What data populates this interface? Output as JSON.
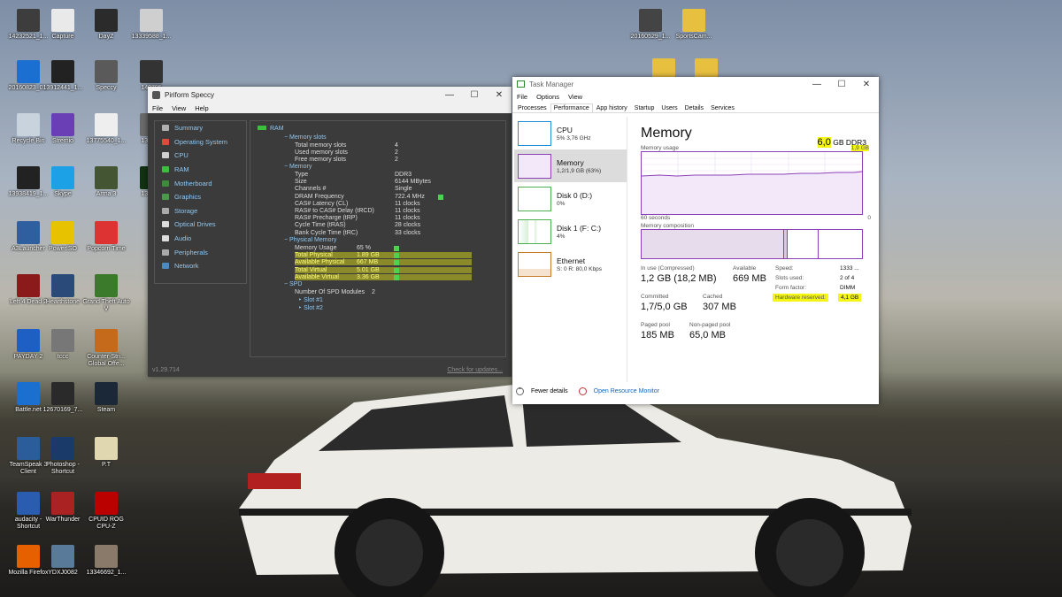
{
  "desktop_icons": [
    {
      "label": "14232521_1...",
      "color": "#3d3d3d"
    },
    {
      "label": "Capture",
      "color": "#e9e9e9"
    },
    {
      "label": "DayZ",
      "color": "#2b2b2b"
    },
    {
      "label": "13339588_1...",
      "color": "#cfcfcf"
    },
    {
      "label": "20160823_0...",
      "color": "#1a6fd1"
    },
    {
      "label": "13912441_1...",
      "color": "#222"
    },
    {
      "label": "Speccy",
      "color": "#5a5a5a"
    },
    {
      "label": "140795",
      "color": "#333"
    },
    {
      "label": "Recycle Bin",
      "color": "#c9d3de"
    },
    {
      "label": "Stremio",
      "color": "#6a3fb6"
    },
    {
      "label": "13775540_1...",
      "color": "#eeeeee"
    },
    {
      "label": "132661",
      "color": "#6b6b6b"
    },
    {
      "label": "13938419_1...",
      "color": "#222"
    },
    {
      "label": "Skype",
      "color": "#1da1e6"
    },
    {
      "label": "Arma 3",
      "color": "#445533"
    },
    {
      "label": "139129",
      "color": "#113311"
    },
    {
      "label": "A3Launcher",
      "color": "#2f5f9f"
    },
    {
      "label": "PowerISO",
      "color": "#e6c200"
    },
    {
      "label": "Popcorn Time",
      "color": "#d33"
    },
    {
      "label": "Left 4 Dead 2",
      "color": "#8b1a1a"
    },
    {
      "label": "Hearthstone",
      "color": "#2a4a7a"
    },
    {
      "label": "Grand Theft Auto V",
      "color": "#3a7a2a"
    },
    {
      "label": "PAYDAY 2",
      "color": "#1d5fc2"
    },
    {
      "label": "tccc",
      "color": "#777"
    },
    {
      "label": "Counter-Stri... Global Offe...",
      "color": "#c46a1a"
    },
    {
      "label": "Battle.net",
      "color": "#1b6fcf"
    },
    {
      "label": "12670169_7...",
      "color": "#2a2a2a"
    },
    {
      "label": "Steam",
      "color": "#1b2838"
    },
    {
      "label": "TeamSpeak 3 Client",
      "color": "#2b5d9a"
    },
    {
      "label": "Photoshop - Shortcut",
      "color": "#1a3a6a"
    },
    {
      "label": "P.T",
      "color": "#e0d7b0"
    },
    {
      "label": "audacity - Shortcut",
      "color": "#2a5db0"
    },
    {
      "label": "WarThunder",
      "color": "#a22"
    },
    {
      "label": "CPUID ROG CPU-Z",
      "color": "#b00"
    },
    {
      "label": "Mozilla Firefox",
      "color": "#e66000"
    },
    {
      "label": "YDXJ0082",
      "color": "#5a7a9a"
    },
    {
      "label": "13346692_1...",
      "color": "#8a7a6a"
    },
    {
      "label": "20160529_1...",
      "color": "#444"
    },
    {
      "label": "SportsCam...",
      "color": "#e8c040"
    }
  ],
  "speccy": {
    "title": "Piriform Speccy",
    "menu": [
      "File",
      "View",
      "Help"
    ],
    "nav": [
      {
        "label": "Summary",
        "color": "#b0b0b0"
      },
      {
        "label": "Operating System",
        "color": "#e04a3a"
      },
      {
        "label": "CPU",
        "color": "#d0d0d0"
      },
      {
        "label": "RAM",
        "color": "#3cbf3c"
      },
      {
        "label": "Motherboard",
        "color": "#3c8c3c"
      },
      {
        "label": "Graphics",
        "color": "#4a9a4a"
      },
      {
        "label": "Storage",
        "color": "#aaaaaa"
      },
      {
        "label": "Optical Drives",
        "color": "#dddddd"
      },
      {
        "label": "Audio",
        "color": "#dddddd"
      },
      {
        "label": "Peripherals",
        "color": "#aaaaaa"
      },
      {
        "label": "Network",
        "color": "#4a8ac0"
      }
    ],
    "ram_header": "RAM",
    "memory_slots": {
      "title": "Memory slots",
      "rows": [
        [
          "Total memory slots",
          "4"
        ],
        [
          "Used memory slots",
          "2"
        ],
        [
          "Free memory slots",
          "2"
        ]
      ]
    },
    "memory": {
      "title": "Memory",
      "rows": [
        [
          "Type",
          "DDR3"
        ],
        [
          "Size",
          "6144 MBytes"
        ],
        [
          "Channels #",
          "Single"
        ],
        [
          "DRAM Frequency",
          "722.4 MHz"
        ],
        [
          "CAS# Latency (CL)",
          "11 clocks"
        ],
        [
          "RAS# to CAS# Delay (tRCD)",
          "11 clocks"
        ],
        [
          "RAS# Precharge (tRP)",
          "11 clocks"
        ],
        [
          "Cycle Time (tRAS)",
          "28 clocks"
        ],
        [
          "Bank Cycle Time (tRC)",
          "33 clocks"
        ]
      ]
    },
    "physical_memory": {
      "title": "Physical Memory",
      "rows": [
        [
          "Memory Usage",
          "65 %"
        ],
        [
          "Total Physical",
          "1.89 GB"
        ],
        [
          "Available Physical",
          "667 MB"
        ],
        [
          "Total Virtual",
          "5.01 GB"
        ],
        [
          "Available Virtual",
          "3.36 GB"
        ]
      ]
    },
    "spd": {
      "title": "SPD",
      "modules_label": "Number Of SPD Modules",
      "modules_value": "2",
      "slots": [
        "Slot #1",
        "Slot #2"
      ]
    },
    "version": "v1.29.714",
    "check_updates": "Check for updates..."
  },
  "taskmgr": {
    "title": "Task Manager",
    "menu": [
      "File",
      "Options",
      "View"
    ],
    "tabs": [
      "Processes",
      "Performance",
      "App history",
      "Startup",
      "Users",
      "Details",
      "Services"
    ],
    "active_tab": "Performance",
    "resources": [
      {
        "name": "CPU",
        "sub": "5% 3,76 GHz",
        "border": "#1f8dd6"
      },
      {
        "name": "Memory",
        "sub": "1,2/1,9 GB (63%)",
        "border": "#8b3fb7"
      },
      {
        "name": "Disk 0 (D:)",
        "sub": "0%",
        "border": "#4caf50"
      },
      {
        "name": "Disk 1 (F: C:)",
        "sub": "4%",
        "border": "#4caf50"
      },
      {
        "name": "Ethernet",
        "sub": "S: 0 R: 80,0 Kbps",
        "border": "#c77a2a"
      }
    ],
    "memory": {
      "title": "Memory",
      "total_num": "6,0",
      "total_unit": "GB DDR3",
      "usage_label": "Memory usage",
      "usage_max": "1,9 GB",
      "time_left": "60 seconds",
      "time_right": "0",
      "composition_label": "Memory composition",
      "in_use_label": "In use (Compressed)",
      "in_use_value": "1,2 GB (18,2 MB)",
      "available_label": "Available",
      "available_value": "669 MB",
      "committed_label": "Committed",
      "committed_value": "1,7/5,0 GB",
      "cached_label": "Cached",
      "cached_value": "307 MB",
      "paged_label": "Paged pool",
      "paged_value": "185 MB",
      "nonpaged_label": "Non-paged pool",
      "nonpaged_value": "65,0 MB",
      "speed_label": "Speed:",
      "speed_value": "1333 ...",
      "slots_label": "Slots used:",
      "slots_value": "2 of 4",
      "form_label": "Form factor:",
      "form_value": "DIMM",
      "hwres_label": "Hardware reserved:",
      "hwres_value": "4,1 GB"
    },
    "fewer_details": "Fewer details",
    "open_monitor": "Open Resource Monitor"
  }
}
